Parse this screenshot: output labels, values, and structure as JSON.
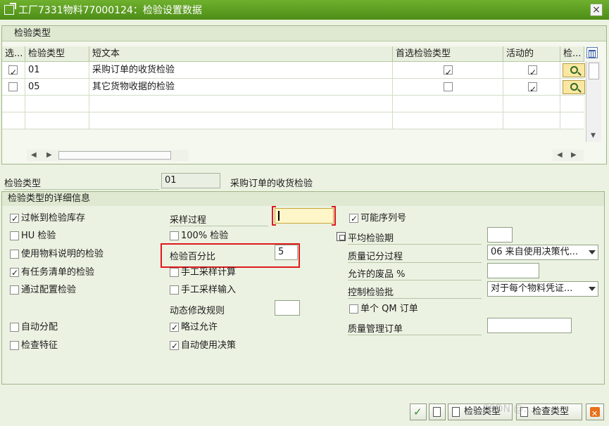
{
  "window": {
    "title": "工厂7331物料77000124：检验设置数据",
    "close": "×"
  },
  "table": {
    "caption": "检验类型",
    "headers": [
      "选...",
      "检验类型",
      "短文本",
      "首选检验类型",
      "活动的",
      "检..."
    ],
    "rows": [
      {
        "selected": true,
        "type": "01",
        "text": "采购订单的收货检验",
        "preferred": true,
        "active": true
      },
      {
        "selected": false,
        "type": "05",
        "text": "其它货物收据的检验",
        "preferred": false,
        "active": true
      }
    ]
  },
  "current": {
    "label": "检验类型",
    "value": "01",
    "text": "采购订单的收货检验"
  },
  "details": {
    "caption": "检验类型的详细信息",
    "col1": [
      {
        "label": "过帐到检验库存",
        "checked": true
      },
      {
        "label": "HU 检验",
        "checked": false
      },
      {
        "label": "使用物料说明的检验",
        "checked": false
      },
      {
        "label": "有任务清单的检验",
        "checked": true
      },
      {
        "label": "通过配置检验",
        "checked": false
      },
      {
        "label": "自动分配",
        "checked": false
      },
      {
        "label": "检查特征",
        "checked": false
      }
    ],
    "sampling_procedure_label": "采样过程",
    "sampling_procedure_value": "",
    "pct100_label": "100% 检验",
    "pct100_checked": false,
    "inspection_pct_label": "检验百分比",
    "inspection_pct_value": "5",
    "manual_sample_calc_label": "手工采样计算",
    "manual_sample_calc_checked": false,
    "manual_sample_input_label": "手工采样输入",
    "manual_sample_input_checked": false,
    "dyn_mod_label": "动态修改规则",
    "dyn_mod_value": "",
    "skip_allowed_label": "略过允许",
    "skip_allowed_checked": true,
    "auto_ud_label": "自动使用决策",
    "auto_ud_checked": true,
    "serial_label": "可能序列号",
    "serial_checked": true,
    "avg_period_label": "平均检验期",
    "avg_period_value": "",
    "qscore_label": "质量记分过程",
    "qscore_value": "06 来自使用决策代...",
    "defect_label": "允许的废品 %",
    "defect_value": "",
    "control_label": "控制检验批",
    "control_value": "对于每个物料凭证...",
    "single_qm_label": "单个 QM 订单",
    "single_qm_checked": false,
    "qm_order_label": "质量管理订单",
    "qm_order_value": ""
  },
  "toolbar": {
    "inspection_types_label": "检验类型",
    "check_types_label": "检查类型"
  },
  "watermark": "CSDN @..."
}
